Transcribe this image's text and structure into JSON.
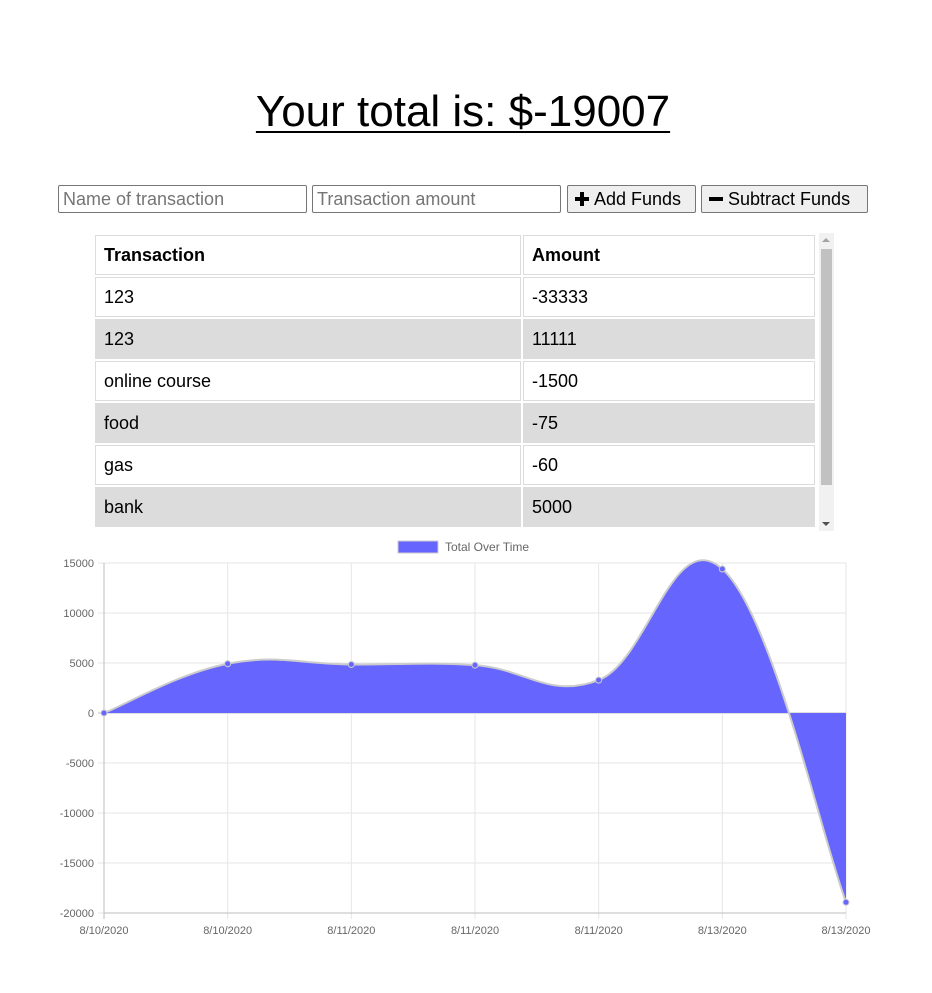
{
  "header": {
    "total_text": "Your total is: $-19007"
  },
  "form": {
    "name_placeholder": "Name of transaction",
    "amount_placeholder": "Transaction amount",
    "add_label": "Add Funds",
    "subtract_label": "Subtract Funds"
  },
  "table": {
    "headers": [
      "Transaction",
      "Amount"
    ],
    "rows": [
      [
        "123",
        "-33333"
      ],
      [
        "123",
        "11111"
      ],
      [
        "online course",
        "-1500"
      ],
      [
        "food",
        "-75"
      ],
      [
        "gas",
        "-60"
      ],
      [
        "bank",
        "5000"
      ]
    ]
  },
  "colors": {
    "fill": "#6666ff",
    "point": "#6666ff",
    "line": "#cccccc",
    "grid": "#e6e6e6"
  },
  "chart_data": {
    "type": "area",
    "x": [
      "8/10/2020",
      "8/10/2020",
      "8/11/2020",
      "8/11/2020",
      "8/11/2020",
      "8/13/2020",
      "8/13/2020"
    ],
    "series": [
      {
        "name": "Total Over Time",
        "values": [
          0,
          4926,
          4851,
          4791,
          3291,
          14402,
          -18931
        ]
      }
    ],
    "ylim": [
      -20000,
      15000
    ],
    "yticks": [
      15000,
      10000,
      5000,
      0,
      -5000,
      -10000,
      -15000,
      -20000
    ],
    "grid": true,
    "legend": "top"
  }
}
